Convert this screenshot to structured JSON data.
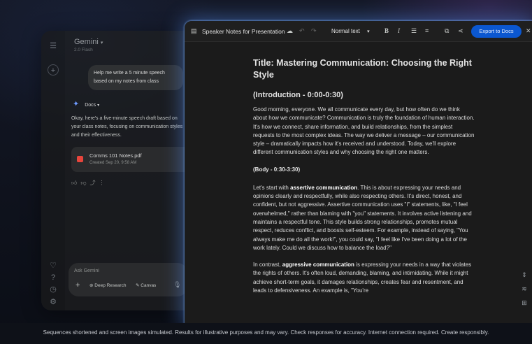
{
  "gemini": {
    "title": "Gemini",
    "model": "2.0 Flash",
    "prompt": "Help me write a 5 minute speech based on my notes from class",
    "source_label": "Docs",
    "reply": "Okay, here's a five-minute speech draft based on your class notes, focusing on communication styles and their effectiveness.",
    "file_name": "Comms 101 Notes.pdf",
    "file_date": "Created Sep 20, 9:58 AM",
    "input_placeholder": "Ask Gemini",
    "chip_research": "Deep Research",
    "chip_canvas": "Canvas"
  },
  "doc_toolbar": {
    "title": "Speaker Notes for Presentation",
    "text_style": "Normal text",
    "export_label": "Export to Docs"
  },
  "doc": {
    "title": "Title: Mastering Communication: Choosing the Right Style",
    "intro_heading": "(Introduction - 0:00-0:30)",
    "intro_text": "Good morning, everyone. We all communicate every day, but how often do we think about how we communicate? Communication is truly the foundation of human interaction. It's how we connect, share information, and build relationships, from the simplest requests to the most complex ideas. The way we deliver a message – our communication style – dramatically impacts how it's received and understood. Today, we'll explore different communication styles and why choosing the right one matters.",
    "body_heading": "(Body - 0:30-3:30)",
    "p1_a": "Let's start with ",
    "p1_bold": "assertive communication",
    "p1_b": ". This is about expressing your needs and opinions clearly and respectfully, while also respecting others. It's direct, honest, and confident, but not aggressive. Assertive communication uses \"I\" statements, like, \"I feel overwhelmed,\" rather than blaming with \"you\" statements. It involves active listening and maintains a respectful tone. This style builds strong relationships, promotes mutual respect, reduces conflict, and boosts self-esteem. For example, instead of saying, \"You always make me do all the work!\", you could say, \"I feel like I've been doing a lot of the work lately. Could we discuss how to balance the load?\"",
    "p2_a": "In contrast, ",
    "p2_bold": "aggressive communication",
    "p2_b": " is expressing your needs in a way that violates the rights of others. It's often loud, demanding, blaming, and intimidating. While it might achieve short-term goals, it damages relationships, creates fear and resentment, and leads to defensiveness. An example is, \"You're"
  },
  "footer": {
    "disclaimer": "Sequences shortened and screen images simulated. Results for illustrative purposes and may vary. Check responses for accuracy. Internet connection required. Create responsibly."
  },
  "colors": {
    "accent": "#0b57d0",
    "canvas_glow": "#5a96ff",
    "pdf_red": "#e8453c",
    "gemini_star": "#6f9bff"
  }
}
